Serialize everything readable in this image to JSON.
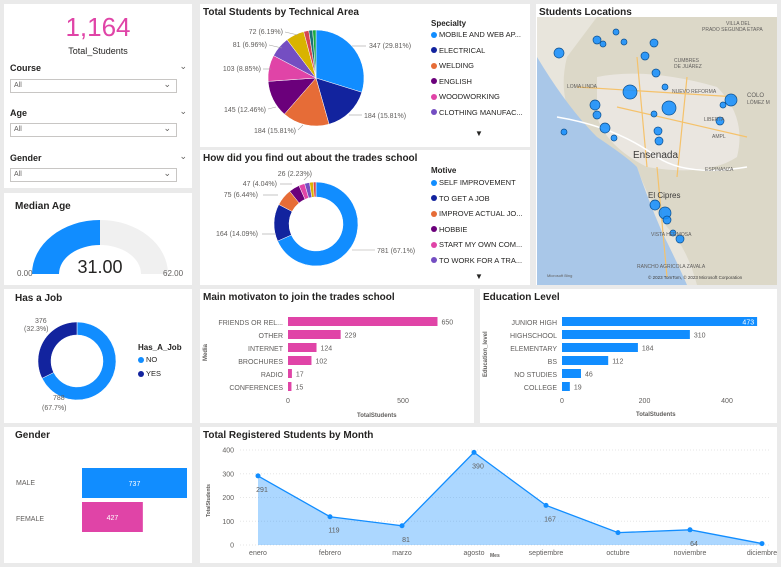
{
  "total_students": {
    "value": "1,164",
    "label": "Total_Students"
  },
  "slicers": [
    {
      "label": "Course",
      "value": "All"
    },
    {
      "label": "Age",
      "value": "All"
    },
    {
      "label": "Gender",
      "value": "All"
    }
  ],
  "median_age": {
    "title": "Median Age",
    "value": "31.00",
    "min": "0.00",
    "max": "62.00",
    "fraction": 0.5
  },
  "has_job": {
    "title": "Has a Job",
    "legend_title": "Has_A_Job",
    "labels": [
      "376",
      "(32.3%)",
      "788",
      "(67.7%)"
    ]
  },
  "gender": {
    "title": "Gender"
  },
  "specialty": {
    "title": "Total Students by Technical Area",
    "legend_title": "Specialty",
    "more_icon": "chevron-down-icon"
  },
  "motive": {
    "title": "How did you find out about the trades school",
    "legend_title": "Motive",
    "more_icon": "chevron-down-icon"
  },
  "locations": {
    "title": "Students Locations",
    "places": [
      "VILLA DEL",
      "PRADO SEGUNDA ETAPA",
      "CUMBRES",
      "DE JUÁREZ",
      "LOMA LINDA",
      "NUEVO REFORMA",
      "COLO",
      "LÓMEZ M",
      "LIBERTA",
      "AMPL",
      "Ensenada",
      "ESPINANZA",
      "El Cipres",
      "VISTA HERMOSA",
      "RANCHO AGRICOLA ZAVALA"
    ],
    "attribution_left": "Microsoft Bing",
    "attribution_right": "© 2023 TomTom, © 2023 Microsoft Corporation"
  },
  "motivation": {
    "title": "Main motivaton to join the trades school"
  },
  "education": {
    "title": "Education Level"
  },
  "monthly": {
    "title": "Total Registered Students by Month"
  },
  "colors": {
    "blue": "#118dff",
    "navy": "#12239e",
    "orange": "#e66c37",
    "purple": "#6b007b",
    "pink": "#e044a7",
    "violet": "#744ec2",
    "yellow": "#d9b300",
    "magenta": "#d64550"
  },
  "chart_data": [
    {
      "type": "pie",
      "title": "Total Students by Technical Area",
      "legend_title": "Specialty",
      "labels": [
        "MOBILE AND WEB AP...",
        "ELECTRICAL",
        "WELDING",
        "ENGLISH",
        "WOODWORKING",
        "CLOTHING MANUFAC..."
      ],
      "slices": [
        {
          "name": "MOBILE AND WEB AP...",
          "value": 347,
          "label": "347 (29.81%)",
          "color": "#118dff"
        },
        {
          "name": "ELECTRICAL",
          "value": 184,
          "label": "184 (15.81%)",
          "color": "#12239e"
        },
        {
          "name": "WELDING",
          "value": 184,
          "label": "184 (15.81%)",
          "color": "#e66c37"
        },
        {
          "name": "ENGLISH",
          "value": 145,
          "label": "145 (12.46%)",
          "color": "#6b007b"
        },
        {
          "name": "WOODWORKING",
          "value": 103,
          "label": "103 (8.85%)",
          "color": "#e044a7"
        },
        {
          "name": "CLOTHING MANUFAC...",
          "value": 81,
          "label": "81 (6.96%)",
          "color": "#744ec2"
        },
        {
          "name": "",
          "value": 72,
          "label": "72 (6.19%)",
          "color": "#d9b300"
        },
        {
          "name": "",
          "value": 20,
          "label": "",
          "color": "#d64550"
        },
        {
          "name": "",
          "value": 15,
          "label": "",
          "color": "#197278"
        },
        {
          "name": "",
          "value": 13,
          "label": "",
          "color": "#1aab40"
        }
      ]
    },
    {
      "type": "pie",
      "title": "How did you find out about the trades school",
      "legend_title": "Motive",
      "donut": true,
      "labels": [
        "SELF IMPROVEMENT",
        "TO GET A JOB",
        "IMPROVE ACTUAL JO...",
        "HOBBIE",
        "START MY OWN COM...",
        "TO WORK FOR A TRA..."
      ],
      "slices": [
        {
          "name": "SELF IMPROVEMENT",
          "value": 781,
          "label": "781 (67.1%)",
          "color": "#118dff"
        },
        {
          "name": "TO GET A JOB",
          "value": 164,
          "label": "164 (14.09%)",
          "color": "#12239e"
        },
        {
          "name": "IMPROVE ACTUAL JO...",
          "value": 75,
          "label": "75 (6.44%)",
          "color": "#e66c37"
        },
        {
          "name": "HOBBIE",
          "value": 47,
          "label": "47 (4.04%)",
          "color": "#6b007b"
        },
        {
          "name": "START MY OWN COM...",
          "value": 26,
          "label": "26 (2.23%)",
          "color": "#e044a7"
        },
        {
          "name": "TO WORK FOR A TRA...",
          "value": 22,
          "label": "",
          "color": "#744ec2"
        },
        {
          "name": "",
          "value": 16,
          "label": "",
          "color": "#d9b300"
        },
        {
          "name": "",
          "value": 12,
          "label": "",
          "color": "#d64550"
        }
      ]
    },
    {
      "type": "pie",
      "title": "Has a Job",
      "donut": true,
      "legend_title": "Has_A_Job",
      "slices": [
        {
          "name": "NO",
          "value": 788,
          "color": "#118dff"
        },
        {
          "name": "YES",
          "value": 376,
          "color": "#12239e"
        }
      ]
    },
    {
      "type": "bar",
      "orientation": "horizontal",
      "title": "Gender",
      "categories": [
        "MALE",
        "FEMALE"
      ],
      "values": [
        737,
        427
      ],
      "colors": [
        "#118dff",
        "#e044a7"
      ]
    },
    {
      "type": "bar",
      "orientation": "horizontal",
      "title": "Main motivaton to join the trades school",
      "categories": [
        "FRIENDS OR REL...",
        "OTHER",
        "INTERNET",
        "BROCHURES",
        "RADIO",
        "CONFERENCES"
      ],
      "values": [
        650,
        229,
        124,
        102,
        17,
        15
      ],
      "ylabel": "Media",
      "xlabel": "TotalStudents",
      "xlim": [
        0,
        700
      ],
      "xticks": [
        "0",
        "500"
      ],
      "color": "#e044a7"
    },
    {
      "type": "bar",
      "orientation": "horizontal",
      "title": "Education Level",
      "categories": [
        "JUNIOR HIGH",
        "HIGHSCHOOL",
        "ELEMENTARY",
        "BS",
        "NO STUDIES",
        "COLLEGE"
      ],
      "values": [
        473,
        310,
        184,
        112,
        46,
        19
      ],
      "ylabel": "Education_level",
      "xlabel": "TotalStudents",
      "xlim": [
        0,
        480
      ],
      "xticks": [
        "0",
        "200",
        "400"
      ],
      "color": "#118dff"
    },
    {
      "type": "area",
      "title": "Total Registered Students by Month",
      "categories": [
        "enero",
        "febrero",
        "marzo",
        "agosto",
        "septiembre",
        "octubre",
        "noviembre",
        "diciembre"
      ],
      "values": [
        291,
        119,
        81,
        390,
        167,
        52,
        64,
        6
      ],
      "value_labels": [
        "291",
        "119",
        "81",
        "390",
        "167",
        "",
        "64",
        ""
      ],
      "xlabel": "Mes",
      "ylabel": "TotalStudents",
      "ylim": [
        0,
        400
      ],
      "yticks": [
        "0",
        "100",
        "200",
        "300",
        "400"
      ],
      "color": "#118dff"
    }
  ]
}
